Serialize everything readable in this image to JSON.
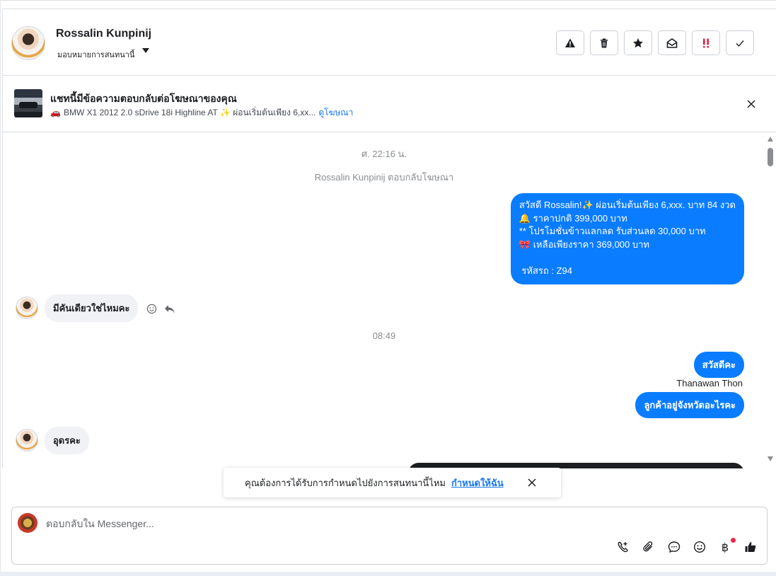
{
  "contact": {
    "name": "Rossalin Kunpinij",
    "assign_label": "มอบหมายการสนทนานี้"
  },
  "header_actions": [
    {
      "name": "report-icon"
    },
    {
      "name": "trash-icon"
    },
    {
      "name": "star-icon"
    },
    {
      "name": "mark-unread-icon"
    },
    {
      "name": "follow-up-icon"
    },
    {
      "name": "done-icon"
    }
  ],
  "ad": {
    "title": "แชทนี้มีข้อความตอบกลับต่อโฆษณาของคุณ",
    "car_emoji": "🚗",
    "subtitle": "BMW X1 2012 2.0 sDrive 18i Highline AT ✨ ผ่อนเริ่มต้นเพียง 6,xx...",
    "link": "ดูโฆษณา"
  },
  "thread": {
    "time_1": "ศ. 22:16 น.",
    "replied_note": "Rossalin Kunpinij ตอบกลับโฆษณา",
    "promo_lines": [
      "สวัสดี Rossalin!✨  ผ่อนเริ่มต้นเพียง 6,xxx. บาท 84 งวด",
      "🔔 ราคาปกติ 399,000 บาท",
      "** โปรโมชั่นข้าวแลกลด รับส่วนลด 30,000 บาท",
      "🎀  เหลือเพียงราคา 369,000 บาท",
      "",
      " รหัสรถ : Z94"
    ],
    "incoming_1": "มีคันเดียวใช่ไหมคะ",
    "time_2": "08:49",
    "outgoing_1": "สวัสดีคะ",
    "sender": "Thanawan Thon",
    "outgoing_2": "ลูกค้าอยู่จังหวัดอะไรคะ",
    "incoming_2": "อุดรคะ"
  },
  "toast": {
    "text": "คุณต้องการได้รับการกำหนดไปยังการสนทนานี้ไหม",
    "link": "กำหนดให้ฉัน"
  },
  "composer": {
    "placeholder": "ตอบกลับใน Messenger...",
    "currency_symbol": "฿"
  },
  "colors": {
    "accent": "#0a7cff",
    "link": "#1877f2",
    "notify": "#f02849"
  }
}
